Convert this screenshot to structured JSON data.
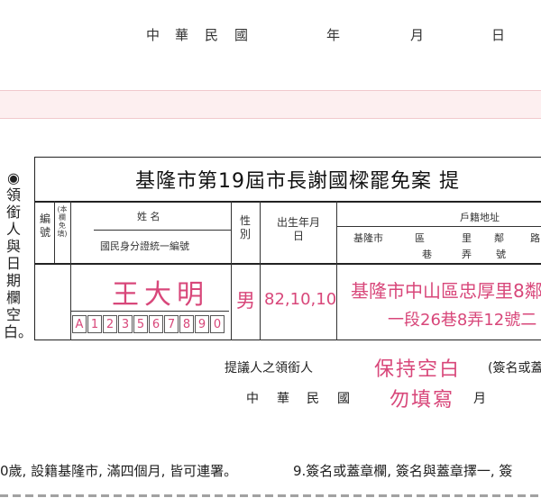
{
  "header": {
    "date_chars": [
      "中",
      "華",
      "民",
      "國",
      "年",
      "月",
      "日"
    ]
  },
  "side_note": "◉領銜人與日期欄空白。",
  "form": {
    "title": "基隆市第19屆市長謝國樑罷免案 提",
    "columns": {
      "number": "編號",
      "number_note": "(本欄免填)",
      "name": "姓 名",
      "id_number": "國民身分證統一編號",
      "gender": "性別",
      "birth": "出生年月日",
      "address": "戶籍地址",
      "address_sub": [
        "基隆市",
        "區",
        "里",
        "鄰",
        "路",
        "巷",
        "弄",
        "號"
      ]
    },
    "row": {
      "name": "王大明",
      "id_chars": [
        "A",
        "1",
        "2",
        "3",
        "5",
        "6",
        "7",
        "8",
        "9",
        "0"
      ],
      "gender": "男",
      "birth": "82,10,10",
      "address_line1": "基隆市中山區忠厚里8鄰",
      "address_line2": "一段26巷8弄12號二"
    }
  },
  "below": {
    "leader_label": "提議人之領銜人",
    "sign_label": "(簽名或蓋",
    "handwritten_1": "保持空白",
    "handwritten_2": "勿填寫",
    "date_chars": [
      "中",
      "華",
      "民",
      "國",
      "月"
    ]
  },
  "footer": {
    "left": "0歲, 設籍基隆市, 滿四個月, 皆可連署。",
    "right": "9.簽名或蓋章欄, 簽名與蓋章擇一, 簽"
  }
}
